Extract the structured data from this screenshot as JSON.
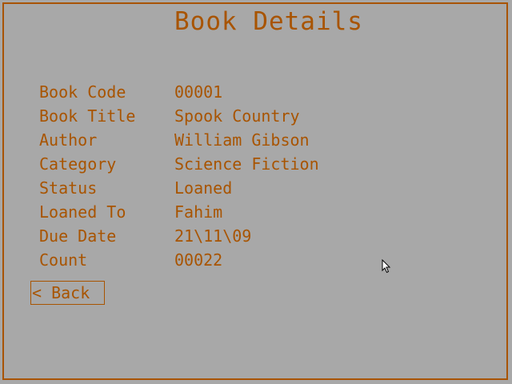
{
  "screen": {
    "title": "Book Details"
  },
  "details": [
    {
      "label": "Book Code",
      "value": "00001"
    },
    {
      "label": "Book Title",
      "value": "Spook Country"
    },
    {
      "label": "Author",
      "value": "William Gibson"
    },
    {
      "label": "Category",
      "value": "Science Fiction"
    },
    {
      "label": "Status",
      "value": "Loaned"
    },
    {
      "label": "Loaned To",
      "value": "Fahim"
    },
    {
      "label": "Due Date",
      "value": "21\\11\\09"
    },
    {
      "label": "Count",
      "value": "00022"
    }
  ],
  "actions": {
    "back_label": "< Back"
  },
  "icons": {
    "cursor": "mouse-pointer-icon"
  },
  "colors": {
    "background": "#a8a8a8",
    "foreground": "#a85400"
  }
}
